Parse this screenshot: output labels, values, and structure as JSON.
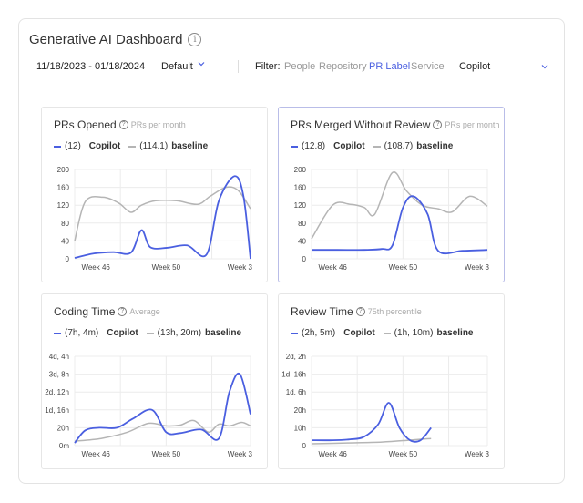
{
  "header": {
    "title": "Generative AI Dashboard",
    "info_glyph": "i"
  },
  "filters": {
    "date_range": "11/18/2023 - 01/18/2024",
    "preset": "Default",
    "filter_label": "Filter:",
    "options": [
      "People",
      "Repository",
      "PR Label",
      "Service"
    ],
    "active_option": "PR Label",
    "selected_value": "Copilot"
  },
  "colors": {
    "copilot": "#4a5fe0",
    "baseline": "#b5b5b5",
    "grid": "#ececec",
    "active": "#4a5fe0"
  },
  "panels": [
    {
      "title": "PRs Opened",
      "subtitle": "PRs per month",
      "selected": false,
      "legend": {
        "copilot_value": "(12)",
        "copilot_name": "Copilot",
        "baseline_value": "(114.1)",
        "baseline_name": "baseline"
      }
    },
    {
      "title": "PRs Merged Without Review",
      "subtitle": "PRs per month",
      "selected": true,
      "legend": {
        "copilot_value": "(12.8)",
        "copilot_name": "Copilot",
        "baseline_value": "(108.7)",
        "baseline_name": "baseline"
      }
    },
    {
      "title": "Coding Time",
      "subtitle": "Average",
      "selected": false,
      "legend": {
        "copilot_value": "(7h, 4m)",
        "copilot_name": "Copilot",
        "baseline_value": "(13h, 20m)",
        "baseline_name": "baseline"
      }
    },
    {
      "title": "Review Time",
      "subtitle": "75th percentile",
      "selected": false,
      "legend": {
        "copilot_value": "(2h, 5m)",
        "copilot_name": "Copilot",
        "baseline_value": "(1h, 10m)",
        "baseline_name": "baseline"
      }
    }
  ],
  "chart_data": [
    {
      "type": "line",
      "title": "PRs Opened",
      "x_labels": [
        "Week 46",
        "Week 50",
        "Week 3"
      ],
      "y_ticks": [
        "0",
        "40",
        "80",
        "120",
        "160",
        "200"
      ],
      "ylim": [
        0,
        200
      ],
      "series": [
        {
          "name": "Copilot",
          "x": [
            0,
            0.11,
            0.22,
            0.32,
            0.38,
            0.43,
            0.53,
            0.64,
            0.75,
            0.82,
            0.91,
            0.96,
            1.0
          ],
          "y": [
            2,
            12,
            15,
            14,
            64,
            26,
            25,
            30,
            10,
            130,
            185,
            140,
            0
          ]
        },
        {
          "name": "baseline",
          "x": [
            0,
            0.06,
            0.16,
            0.25,
            0.32,
            0.38,
            0.46,
            0.58,
            0.7,
            0.77,
            0.86,
            0.93,
            1.0
          ],
          "y": [
            40,
            128,
            138,
            125,
            104,
            120,
            130,
            130,
            122,
            140,
            160,
            153,
            112
          ]
        }
      ]
    },
    {
      "type": "line",
      "title": "PRs Merged Without Review",
      "x_labels": [
        "Week 46",
        "Week 50",
        "Week 3"
      ],
      "y_ticks": [
        "0",
        "40",
        "80",
        "120",
        "160",
        "200"
      ],
      "ylim": [
        0,
        200
      ],
      "series": [
        {
          "name": "Copilot",
          "x": [
            0,
            0.15,
            0.3,
            0.4,
            0.46,
            0.52,
            0.58,
            0.66,
            0.72,
            0.86,
            1.0
          ],
          "y": [
            20,
            20,
            20,
            22,
            30,
            115,
            140,
            100,
            18,
            18,
            20
          ]
        },
        {
          "name": "baseline",
          "x": [
            0,
            0.12,
            0.22,
            0.3,
            0.36,
            0.46,
            0.54,
            0.63,
            0.72,
            0.8,
            0.9,
            1.0
          ],
          "y": [
            45,
            120,
            122,
            115,
            100,
            193,
            152,
            120,
            112,
            105,
            140,
            118
          ]
        }
      ]
    },
    {
      "type": "line",
      "title": "Coding Time",
      "x_labels": [
        "Week 46",
        "Week 50",
        "Week 3"
      ],
      "y_ticks": [
        "0m",
        "20h",
        "1d, 16h",
        "2d, 12h",
        "3d, 8h",
        "4d, 4h"
      ],
      "ylim": [
        0,
        100
      ],
      "series": [
        {
          "name": "Copilot",
          "x": [
            0,
            0.06,
            0.14,
            0.24,
            0.33,
            0.44,
            0.52,
            0.6,
            0.72,
            0.82,
            0.88,
            0.94,
            1.0
          ],
          "y": [
            3,
            17,
            20,
            20,
            30,
            40,
            15,
            14,
            18,
            8,
            60,
            80,
            35
          ]
        },
        {
          "name": "baseline",
          "x": [
            0,
            0.15,
            0.3,
            0.42,
            0.52,
            0.6,
            0.68,
            0.76,
            0.82,
            0.88,
            0.95,
            1.0
          ],
          "y": [
            5,
            8,
            15,
            25,
            22,
            23,
            28,
            15,
            24,
            22,
            26,
            22
          ]
        }
      ]
    },
    {
      "type": "line",
      "title": "Review Time",
      "x_labels": [
        "Week 46",
        "Week 50",
        "Week 3"
      ],
      "y_ticks": [
        "0",
        "10h",
        "20h",
        "1d, 6h",
        "1d, 16h",
        "2d, 2h"
      ],
      "ylim": [
        0,
        50
      ],
      "series": [
        {
          "name": "Copilot",
          "x": [
            0,
            0.12,
            0.22,
            0.3,
            0.38,
            0.44,
            0.5,
            0.56,
            0.62,
            0.68
          ],
          "y": [
            3,
            3,
            3.5,
            5,
            12,
            24,
            10,
            3,
            3,
            10
          ]
        },
        {
          "name": "baseline",
          "x": [
            0,
            0.2,
            0.4,
            0.55,
            0.68
          ],
          "y": [
            1,
            1.5,
            2,
            3,
            4
          ]
        }
      ]
    }
  ]
}
